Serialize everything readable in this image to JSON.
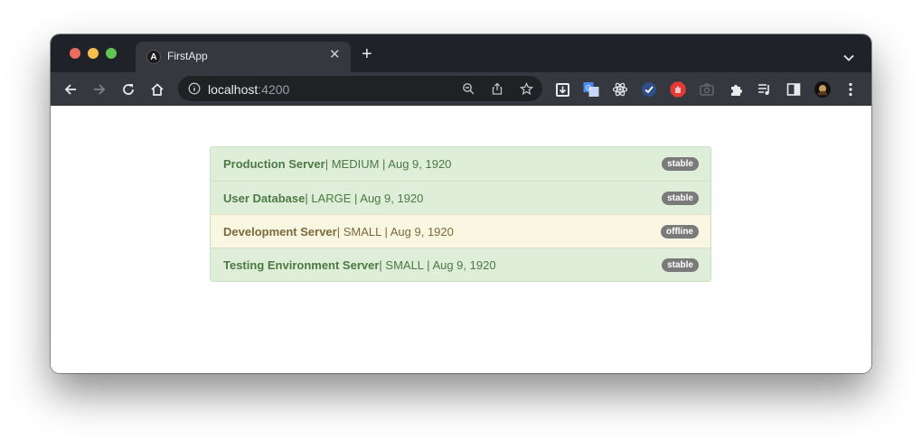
{
  "browser": {
    "tab_title": "FirstApp",
    "tab_favicon": "A",
    "url_host": "localhost",
    "url_port": ":4200"
  },
  "servers": [
    {
      "name": "Production Server",
      "details": " | MEDIUM | Aug 9, 1920",
      "status": "stable"
    },
    {
      "name": "User Database",
      "details": " | LARGE | Aug 9, 1920",
      "status": "stable"
    },
    {
      "name": "Development Server",
      "details": " | SMALL | Aug 9, 1920",
      "status": "offline"
    },
    {
      "name": "Testing Environment Server",
      "details": " | SMALL | Aug 9, 1920",
      "status": "stable"
    }
  ],
  "colors": {
    "stable_bg": "#dfeed9",
    "offline_bg": "#f9f6e2",
    "badge": "#7a7a7a"
  }
}
